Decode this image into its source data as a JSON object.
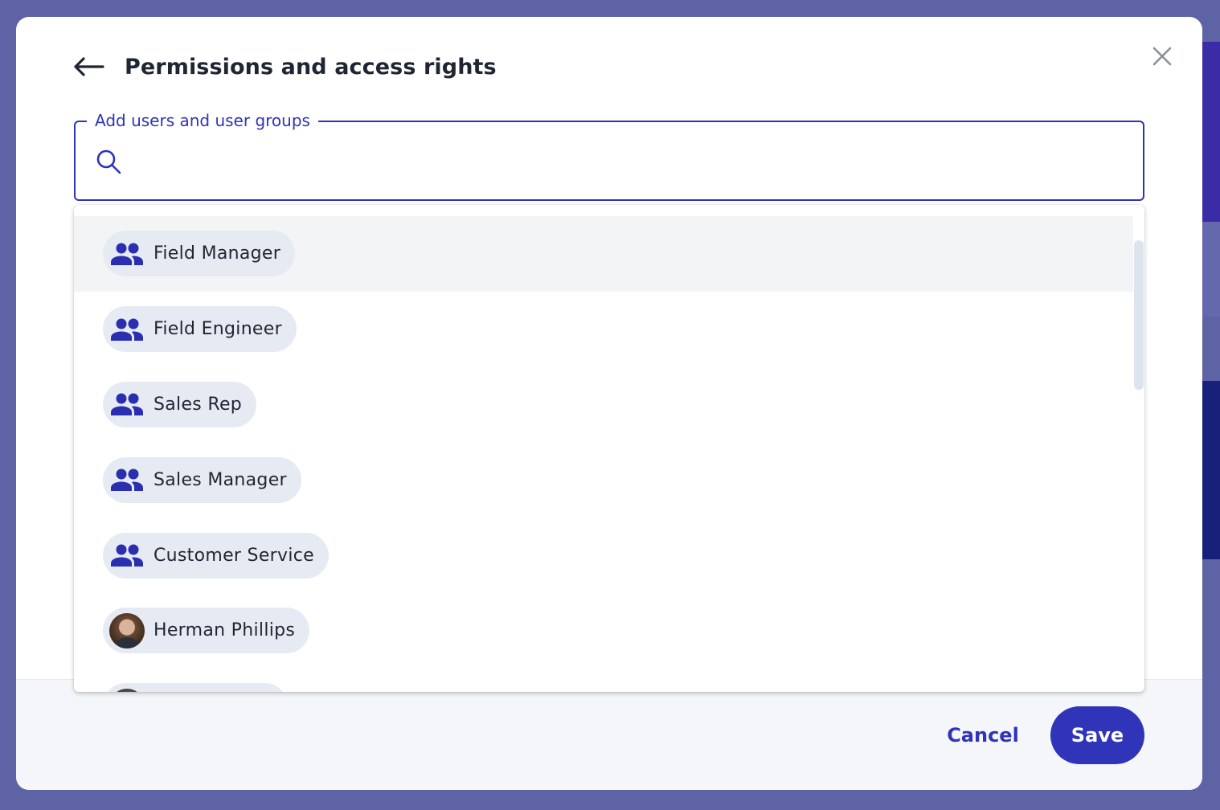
{
  "dialog": {
    "title": "Permissions and access rights",
    "back_icon": "arrow-left-icon",
    "close_icon": "close-icon"
  },
  "search": {
    "legend": "Add users and user groups",
    "value": "",
    "placeholder": "",
    "icon": "search-icon"
  },
  "options": [
    {
      "type": "group",
      "label": "Field Manager",
      "icon": "user-group-icon",
      "highlighted": true
    },
    {
      "type": "group",
      "label": "Field Engineer",
      "icon": "user-group-icon"
    },
    {
      "type": "group",
      "label": "Sales Rep",
      "icon": "user-group-icon"
    },
    {
      "type": "group",
      "label": "Sales Manager",
      "icon": "user-group-icon"
    },
    {
      "type": "group",
      "label": "Customer Service",
      "icon": "user-group-icon"
    },
    {
      "type": "user",
      "label": "Herman Phillips",
      "icon": "user-avatar"
    },
    {
      "type": "user",
      "label": "",
      "icon": "user-avatar"
    }
  ],
  "footer": {
    "cancel_label": "Cancel",
    "save_label": "Save"
  },
  "colors": {
    "accent": "#2f34b8",
    "chip_bg": "#e6eaf3",
    "highlight_bg": "#f3f4f5",
    "backdrop": "#5e63a6"
  }
}
